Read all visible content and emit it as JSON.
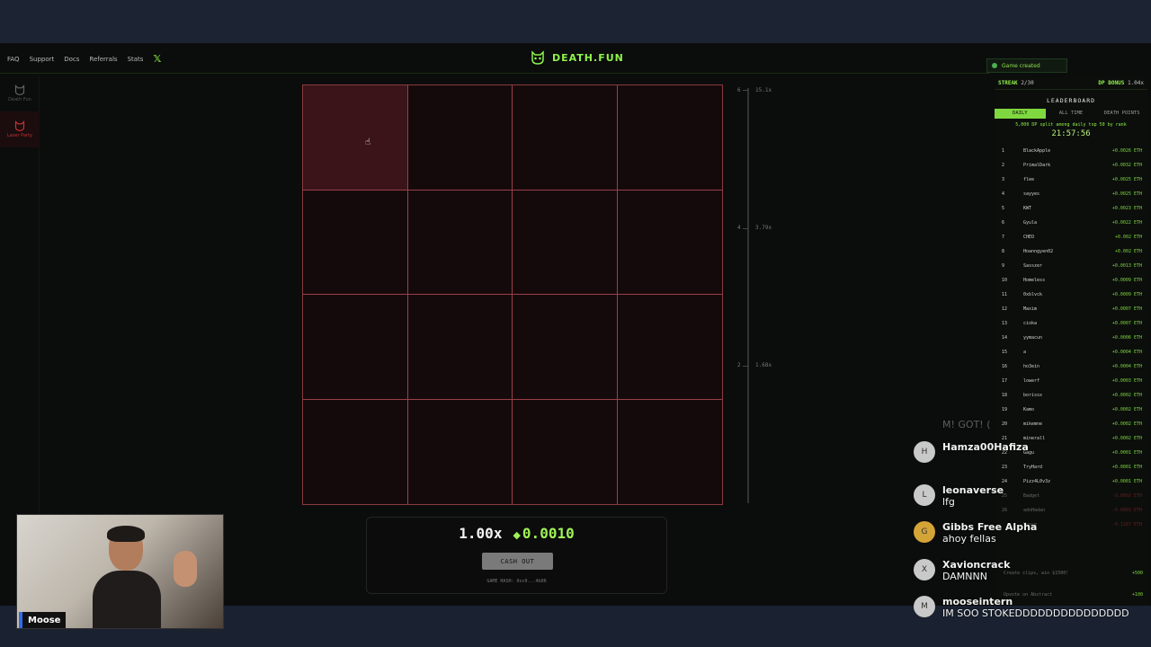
{
  "nav": {
    "items": [
      "FAQ",
      "Support",
      "Docs",
      "Referrals",
      "Stats"
    ],
    "x_icon": "x-logo-icon"
  },
  "brand": {
    "name": "DEATH.FUN",
    "icon": "cat-skull-icon"
  },
  "rail": [
    {
      "label": "Death Fun",
      "icon": "cat-skull-icon",
      "active": false
    },
    {
      "label": "Laser Party",
      "icon": "cat-skull-icon",
      "active": true
    }
  ],
  "board": {
    "rows": 4,
    "columns": 4,
    "hovered_cell": 0
  },
  "scale": {
    "labels": [
      {
        "row": "6",
        "mult": "15.1x"
      },
      {
        "row": "4",
        "mult": "3.79x"
      },
      {
        "row": "2",
        "mult": "1.68x"
      }
    ]
  },
  "bet": {
    "multiplier": "1.00x",
    "amount": "0.0010",
    "cashout_label": "CASH OUT",
    "game_hash": "GAME HASH: 0xc0...4b06"
  },
  "toast": {
    "text": "Game created"
  },
  "streak": {
    "label": "STREAK",
    "value": "2/30",
    "bonus_label": "DP BONUS",
    "bonus_value": "1.04x"
  },
  "leaderboard": {
    "title": "LEADERBOARD",
    "tabs": [
      "DAILY",
      "ALL TIME",
      "DEATH POINTS"
    ],
    "active_tab": "DAILY",
    "note": "5,000 DP split among daily top 50 by rank",
    "timer": "21:57:56",
    "rows": [
      {
        "rank": "1",
        "name": "BlackApple",
        "value": "+0.0026 ETH"
      },
      {
        "rank": "2",
        "name": "PrimalDark",
        "value": "+0.0032 ETH"
      },
      {
        "rank": "3",
        "name": "flee",
        "value": "+0.0025 ETH"
      },
      {
        "rank": "4",
        "name": "sayyes",
        "value": "+0.0025 ETH"
      },
      {
        "rank": "5",
        "name": "KWT",
        "value": "+0.0023 ETH"
      },
      {
        "rank": "6",
        "name": "Gyula",
        "value": "+0.0022 ETH"
      },
      {
        "rank": "7",
        "name": "CHEO",
        "value": "+0.002 ETH"
      },
      {
        "rank": "8",
        "name": "Hoanngyen02",
        "value": "+0.002 ETH"
      },
      {
        "rank": "9",
        "name": "Sasszer",
        "value": "+0.0013 ETH"
      },
      {
        "rank": "10",
        "name": "Homeless",
        "value": "+0.0009 ETH"
      },
      {
        "rank": "11",
        "name": "0xblvck",
        "value": "+0.0009 ETH"
      },
      {
        "rank": "12",
        "name": "Maxim",
        "value": "+0.0007 ETH"
      },
      {
        "rank": "13",
        "name": "cioka",
        "value": "+0.0007 ETH"
      },
      {
        "rank": "14",
        "name": "yymacun",
        "value": "+0.0006 ETH"
      },
      {
        "rank": "15",
        "name": "a",
        "value": "+0.0004 ETH"
      },
      {
        "rank": "16",
        "name": "ho3ein",
        "value": "+0.0004 ETH"
      },
      {
        "rank": "17",
        "name": "lowerf",
        "value": "+0.0003 ETH"
      },
      {
        "rank": "18",
        "name": "borissx",
        "value": "+0.0002 ETH"
      },
      {
        "rank": "19",
        "name": "Kamo",
        "value": "+0.0002 ETH"
      },
      {
        "rank": "20",
        "name": "mikemne",
        "value": "+0.0002 ETH"
      },
      {
        "rank": "21",
        "name": "minerall",
        "value": "+0.0002 ETH"
      },
      {
        "rank": "22",
        "name": "Gagu",
        "value": "+0.0001 ETH"
      },
      {
        "rank": "23",
        "name": "TryHard",
        "value": "+0.0001 ETH"
      },
      {
        "rank": "24",
        "name": "Pizz4L0v3z",
        "value": "+0.0001 ETH"
      },
      {
        "rank": "25",
        "name": "Badget",
        "value": "-0.0002 ETH"
      },
      {
        "rank": "26",
        "name": "adoHadan",
        "value": "-0.0003 ETH"
      },
      {
        "rank": "",
        "name": "Moose",
        "value": "-0.1287 ETH"
      }
    ]
  },
  "tasks": [
    {
      "label": "Create clips, win $1500!",
      "reward": "+500"
    },
    {
      "label": "Upvote on Abstract",
      "reward": "+100"
    }
  ],
  "chat": {
    "faded_name": "M! GOT! (",
    "messages": [
      {
        "avatar": "H",
        "name": "Hamza00Hafiza",
        "text": ""
      },
      {
        "avatar": "L",
        "name": "leonaverse",
        "text": "lfg"
      },
      {
        "avatar": "G",
        "name": "Gibbs Free Alpha",
        "text": "ahoy fellas"
      },
      {
        "avatar": "X",
        "name": "Xavioncrack",
        "text": "DAMNNN"
      },
      {
        "avatar": "M",
        "name": "mooseintern",
        "text": "IM SOO STOKEDDDDDDDDDDDDDDD"
      }
    ]
  },
  "webcam": {
    "label": "Moose"
  }
}
